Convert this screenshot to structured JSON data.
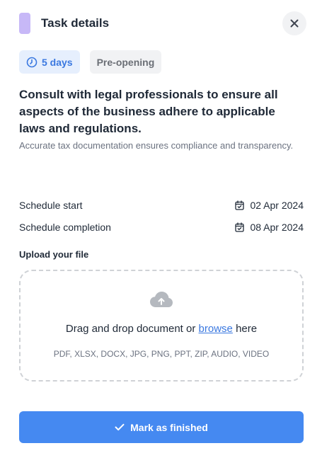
{
  "header": {
    "title": "Task details",
    "accent_color": "#c7b8f7"
  },
  "badges": {
    "duration": "5 days",
    "phase": "Pre-opening"
  },
  "task": {
    "title": "Consult with legal professionals to ensure all aspects of the business adhere to applicable laws and regulations.",
    "description": "Accurate tax documentation ensures compliance and transparency."
  },
  "schedule": {
    "start_label": "Schedule start",
    "start_date": "02 Apr 2024",
    "completion_label": "Schedule completion",
    "completion_date": "08 Apr 2024"
  },
  "upload": {
    "label": "Upload your file",
    "drag_text": "Drag and drop document or",
    "browse_text": "browse",
    "here_text": "here",
    "formats": "PDF, XLSX, DOCX, JPG, PNG, PPT, ZIP, AUDIO, VIDEO"
  },
  "actions": {
    "finish_label": "Mark as finished",
    "primary_color": "#4589f1"
  },
  "icons": [
    "close-icon",
    "clock-icon",
    "calendar-check-icon",
    "cloud-upload-icon",
    "check-icon"
  ]
}
